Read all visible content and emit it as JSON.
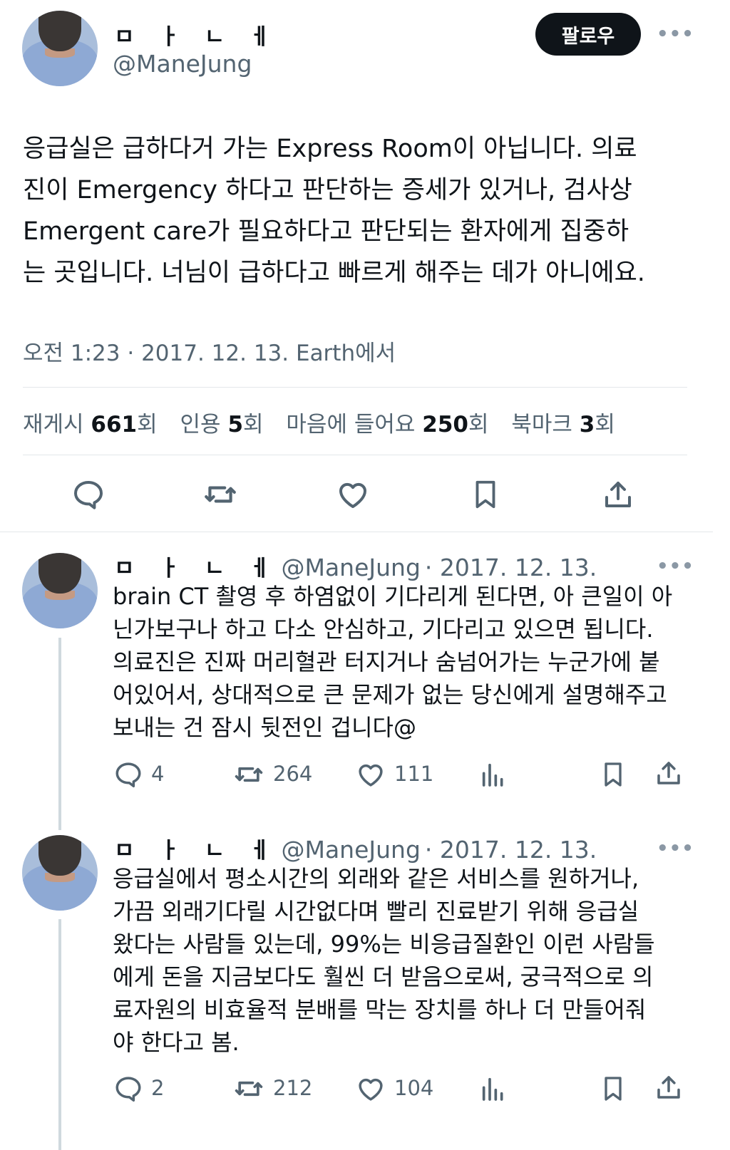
{
  "main_tweet": {
    "author_name": "ㅁ ㅏ ㄴ ㅔ",
    "author_handle": "@ManeJung",
    "follow_label": "팔로우",
    "more_label": "•••",
    "text": "응급실은 급하다거 가는 Express Room이 아닙니다. 의료진이 Emergency 하다고 판단하는 증세가 있거나, 검사상 Emergent care가 필요하다고 판단되는 환자에게 집중하는 곳입니다. 너님이 급하다고 빠르게 해주는 데가 아니에요.",
    "text_lines": [
      "응급실은 급하다거 가는 Express Room이 아닙니다. 의료",
      "진이 Emergency 하다고 판단하는 증세가 있거나, 검사상",
      "Emergent care가 필요하다고 판단되는 환자에게 집중하",
      "는 곳입니다. 너님이 급하다고 빠르게 해주는 데가 아니에요."
    ],
    "timestamp": "오전 1:23 · 2017. 12. 13. Earth에서",
    "stats": {
      "repost_label": "재게시",
      "repost_count": "661",
      "repost_unit": "회",
      "quote_label": "인용",
      "quote_count": "5",
      "quote_unit": "회",
      "like_label": "마음에 들어요",
      "like_count": "250",
      "like_unit": "회",
      "bookmark_label": "북마크",
      "bookmark_count": "3",
      "bookmark_unit": "회"
    },
    "actions": [
      "reply-icon",
      "repost-icon",
      "like-icon",
      "bookmark-icon",
      "share-icon"
    ]
  },
  "replies": [
    {
      "author_name": "ㅁ ㅏ ㄴ ㅔ",
      "author_handle": "@ManeJung",
      "date": "· 2017. 12. 13.",
      "more_label": "•••",
      "text_lines": [
        "brain CT 촬영 후 하염없이 기다리게 된다면, 아 큰일이 아",
        "닌가보구나 하고 다소 안심하고, 기다리고 있으면 됩니다.",
        "의료진은 진짜 머리혈관 터지거나 숨넘어가는 누군가에 붙",
        "어있어서, 상대적으로 큰 문제가 없는 당신에게 설명해주고",
        "보내는 건 잠시 뒷전인 겁니다@"
      ],
      "reply_count": "4",
      "repost_count": "264",
      "like_count": "111"
    },
    {
      "author_name": "ㅁ ㅏ ㄴ ㅔ",
      "author_handle": "@ManeJung",
      "date": "· 2017. 12. 13.",
      "more_label": "•••",
      "text_lines": [
        "응급실에서 평소시간의 외래와 같은 서비스를 원하거나,",
        "가끔 외래기다릴 시간없다며 빨리 진료받기 위해 응급실",
        "왔다는 사람들 있는데, 99%는 비응급질환인 이런 사람들",
        "에게 돈을 지금보다도 훨씬 더 받음으로써, 궁극적으로 의",
        "료자원의 비효율적 분배를 막는 장치를 하나 더 만들어줘",
        "야 한다고 봄."
      ],
      "reply_count": "2",
      "repost_count": "212",
      "like_count": "104"
    }
  ],
  "colors": {
    "text": "#0f1419",
    "secondary": "#536471",
    "divider": "#e3e7ea",
    "thread_line": "#cfd9de",
    "follow_bg": "#0f1419"
  }
}
